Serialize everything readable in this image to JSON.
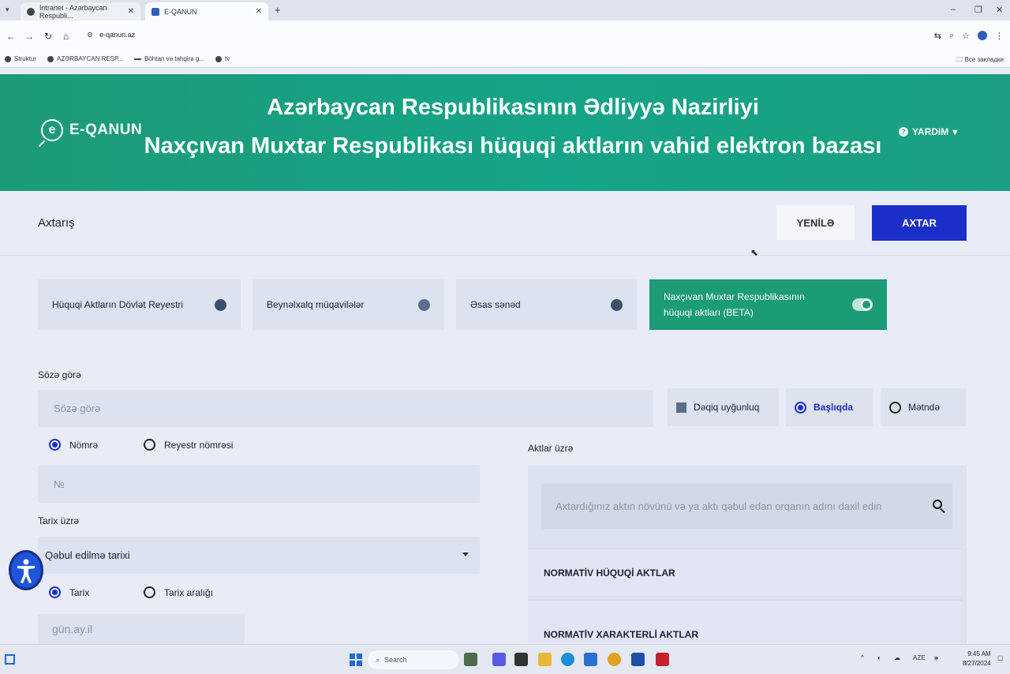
{
  "browser": {
    "tabs": [
      {
        "label": "Intranet - Azərbaycan Respubli..."
      },
      {
        "label": "E-QANUN"
      }
    ],
    "url": "e-qanun.az",
    "bookmarks": [
      {
        "label": "Struktur"
      },
      {
        "label": "AZƏRBAYCAN RESP..."
      },
      {
        "label": "Böhtan və təhqirə g..."
      },
      {
        "label": "tv"
      }
    ],
    "all_bookmarks": "Все закладки"
  },
  "header": {
    "brand": "E-QANUN",
    "title_line1": "Azərbaycan Respublikasının Ədliyyə Nazirliyi",
    "title_line2": "Naxçıvan Muxtar Respublikası hüquqi aktların vahid elektron bazası",
    "help": "YARDIM"
  },
  "search": {
    "title": "Axtarış",
    "reset_label": "YENİLƏ",
    "search_label": "AXTAR"
  },
  "sources": [
    {
      "label": "Hüquqi Aktların Dövlət Reyestri",
      "active": false
    },
    {
      "label": "Beynəlxalq müqavilələr",
      "active": false
    },
    {
      "label": "Əsas sənəd",
      "active": false
    },
    {
      "label": "Naxçıvan Muxtar Respublikasının hüquqi aktları (BETA)",
      "active": true
    }
  ],
  "by_word": {
    "label": "Sözə görə",
    "placeholder": "Sözə görə",
    "exact_match": "Dəqiq uyğunluq",
    "in_title": "Başlıqda",
    "in_text": "Mətndə",
    "selected": "in_title"
  },
  "number": {
    "option_number": "Nömrə",
    "option_registry": "Reyestr nömrəsi",
    "selected": "number",
    "placeholder": "№"
  },
  "by_date": {
    "label": "Tarix üzrə",
    "select_value": "Qəbul edilmə tarixi",
    "option_date": "Tarix",
    "option_range": "Tarix aralığı",
    "selected": "date",
    "date_placeholder": "gün.ay.il"
  },
  "acts": {
    "label": "Aktlar üzrə",
    "search_placeholder": "Axtardığınız aktın növünü və ya aktı qəbul edan orqanın adını daxil edin",
    "categories": [
      "NORMATİV HÜQUQİ AKTLAR",
      "NORMATİV XARAKTERLİ AKTLAR"
    ]
  },
  "taskbar": {
    "search": "Search",
    "language": "AZE",
    "time": "9:45 AM",
    "date": "8/27/2024"
  }
}
